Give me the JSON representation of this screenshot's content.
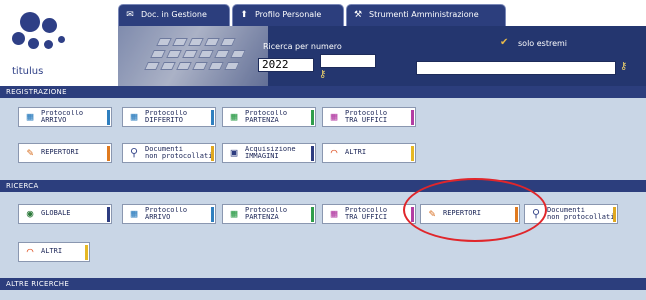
{
  "logo": {
    "text": "titulus"
  },
  "tabs": [
    {
      "label": "Doc. in Gestione",
      "icon": "envelope-icon"
    },
    {
      "label": "Profilo Personale",
      "icon": "person-icon"
    },
    {
      "label": "Strumenti Amministrazione",
      "icon": "tools-icon"
    }
  ],
  "search": {
    "number_label": "Ricerca per numero",
    "year_value": "2022",
    "number_value": "",
    "extreme_value": "",
    "solo_estremi_label": "solo estremi"
  },
  "sections": {
    "registrazione": "REGISTRAZIONE",
    "ricerca": "RICERCA",
    "altre_ricerche": "ALTRE RICERCHE"
  },
  "registrazione_buttons": [
    {
      "label": "Protocollo\nARRIVO",
      "icon": "protocol-arrival-icon",
      "stripe": "#2f7fbf"
    },
    {
      "label": "Protocollo\nDIFFERITO",
      "icon": "protocol-deferred-icon",
      "stripe": "#2f7fbf"
    },
    {
      "label": "Protocollo\nPARTENZA",
      "icon": "protocol-departure-icon",
      "stripe": "#2f9d4b"
    },
    {
      "label": "Protocollo\nTRA UFFICI",
      "icon": "protocol-internal-icon",
      "stripe": "#b33da3"
    },
    {
      "label": "REPERTORI",
      "icon": "repertori-icon",
      "stripe": "#e07a1f"
    },
    {
      "label": "Documenti\nnon protocollati",
      "icon": "paperclip-icon",
      "stripe": "#e0a81f"
    },
    {
      "label": "Acquisizione\nIMMAGINI",
      "icon": "image-acquisition-icon",
      "stripe": "#2d3c80"
    },
    {
      "label": "ALTRI",
      "icon": "rainbow-icon",
      "stripe": "#e6b824"
    }
  ],
  "ricerca_buttons": [
    {
      "label": "GLOBALE",
      "icon": "globe-icon",
      "stripe": "#2d3c80"
    },
    {
      "label": "Protocollo\nARRIVO",
      "icon": "protocol-arrival-icon",
      "stripe": "#2f7fbf"
    },
    {
      "label": "Protocollo\nPARTENZA",
      "icon": "protocol-departure-icon",
      "stripe": "#2f9d4b"
    },
    {
      "label": "Protocollo\nTRA UFFICI",
      "icon": "protocol-internal-icon",
      "stripe": "#b33da3"
    },
    {
      "label": "REPERTORI",
      "icon": "repertori-icon",
      "stripe": "#e07a1f"
    },
    {
      "label": "Documenti\nnon protocollati",
      "icon": "paperclip-icon",
      "stripe": "#e0a81f"
    },
    {
      "label": "ALTRI",
      "icon": "rainbow-icon",
      "stripe": "#e6b824"
    }
  ],
  "colors": {
    "nav_blue": "#2c3e7d",
    "section_bg": "#c9d6e6",
    "highlight_red": "#e0262b"
  }
}
